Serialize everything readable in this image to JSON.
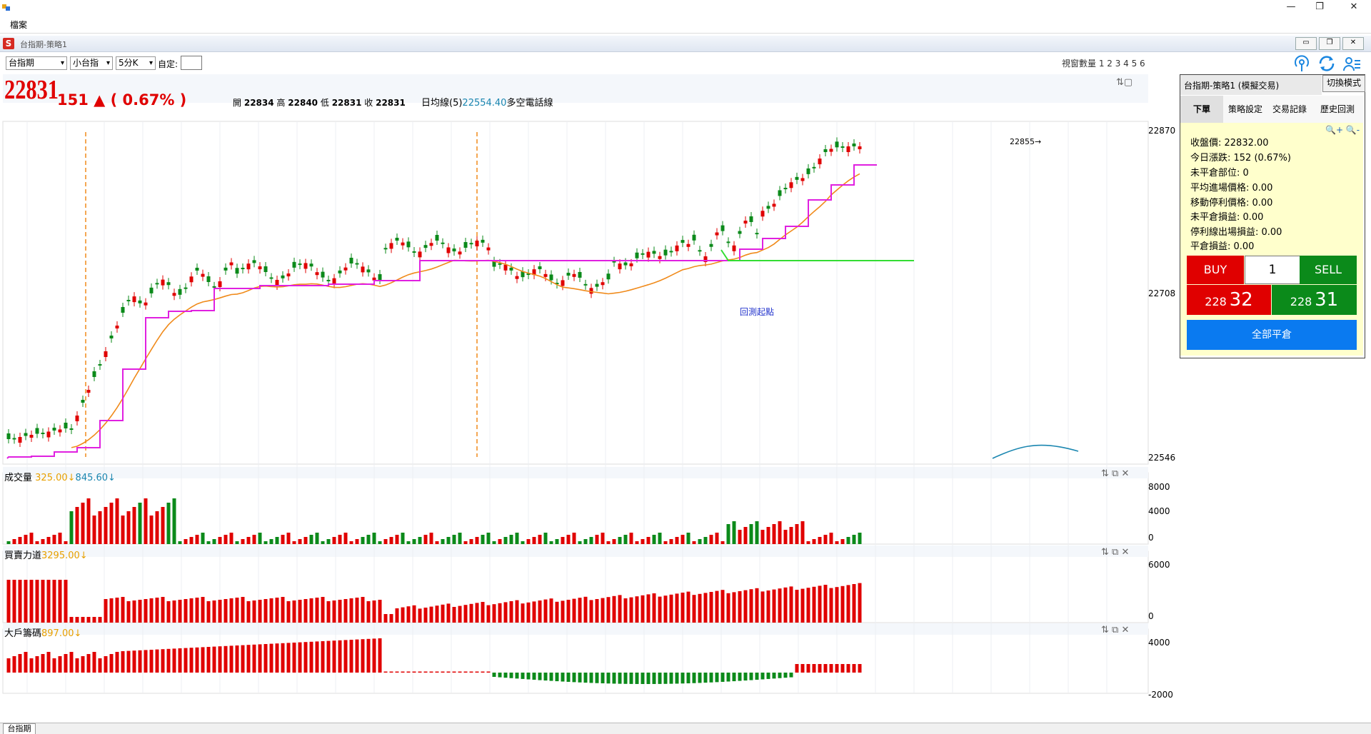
{
  "window": {
    "minimize": "—",
    "restore": "❐",
    "close": "✕"
  },
  "menu": {
    "file": "檔案"
  },
  "child_window": {
    "title": "台指期-策略1",
    "icon_letter": "S"
  },
  "toolbar": {
    "product": "台指期",
    "contract": "小台指",
    "period": "5分K",
    "custom_label": "自定:",
    "window_count": "視窗數量 1 2 3 4 5 6"
  },
  "quote": {
    "last": "22831",
    "change": "151 ▲ ( 0.67% )",
    "open_label": "開",
    "open": "22834",
    "high_label": "高",
    "high": "22840",
    "low_label": "低",
    "low": "22831",
    "close_label": "收",
    "close": "22831",
    "ma_label": "日均線(5)",
    "ma_value": "22554.40",
    "ma_suffix": "多空電話線"
  },
  "main_chart": {
    "annotation_high": "22855→",
    "annotation_backtest": "回測起點",
    "axis_ticks": [
      "22870",
      "22708",
      "22546"
    ]
  },
  "volume_panel": {
    "label": "成交量",
    "val1": "325.00↓",
    "val2": "845.60↓",
    "ticks": [
      "8000",
      "4000",
      "0"
    ]
  },
  "force_panel": {
    "label": "買賣力道",
    "val1": "3295.00↓",
    "ticks": [
      "6000",
      "0"
    ]
  },
  "big_panel": {
    "label": "大戶籌碼",
    "val1": "897.00↓",
    "ticks": [
      "4000",
      "-2000"
    ]
  },
  "panel": {
    "title": "台指期-策略1 (模擬交易)",
    "switch_mode": "切換模式",
    "tabs": [
      "下單",
      "策略設定",
      "交易記錄",
      "歷史回測"
    ],
    "zoom": "🔍+ 🔍-",
    "info": [
      "收盤價: 22832.00",
      "今日漲跌: 152 (0.67%)",
      "未平倉部位: 0",
      "平均進場價格: 0.00",
      "移動停利價格: 0.00",
      "未平倉損益: 0.00",
      "停利線出場損益: 0.00",
      "平倉損益: 0.00"
    ],
    "buy": "BUY",
    "qty": "1",
    "sell": "SELL",
    "bid_small": "228",
    "bid_large": "32",
    "ask_small": "228",
    "ask_large": "31",
    "close_all": "全部平倉"
  },
  "bottom_tab": "台指期",
  "colors": {
    "up": "#e00000",
    "down": "#0b8a1a",
    "ma": "#f08a1a",
    "stop": "#e020e0",
    "backtest": "#33dd33",
    "accent": "#0a7af0"
  }
}
